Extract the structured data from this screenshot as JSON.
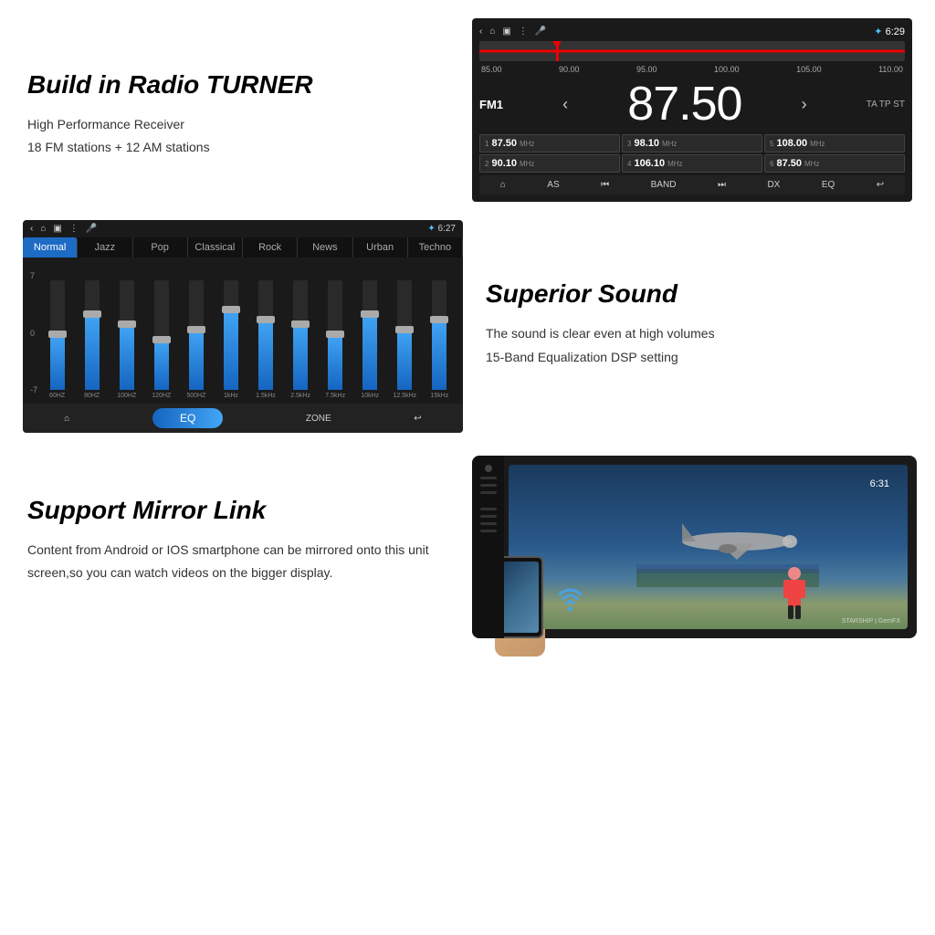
{
  "sections": {
    "radio": {
      "title": "Build in Radio TURNER",
      "feature1": "High Performance Receiver",
      "feature2": "18 FM stations + 12 AM stations",
      "screen": {
        "time": "6:29",
        "band": "FM1",
        "frequency": "87.50",
        "freq_large": "87.50",
        "freq_labels": [
          "85.00",
          "90.00",
          "95.00",
          "100.00",
          "105.00",
          "110.00"
        ],
        "rds": "TA TP ST",
        "presets": [
          {
            "num": "1",
            "freq": "87.50",
            "unit": "MHz"
          },
          {
            "num": "3",
            "freq": "98.10",
            "unit": "MHz"
          },
          {
            "num": "5",
            "freq": "108.00",
            "unit": "MHz"
          },
          {
            "num": "2",
            "freq": "90.10",
            "unit": "MHz"
          },
          {
            "num": "4",
            "freq": "106.10",
            "unit": "MHz"
          },
          {
            "num": "6",
            "freq": "87.50",
            "unit": "MHz"
          }
        ],
        "toolbar_buttons": [
          "🏠",
          "AS",
          "⏮",
          "BAND",
          "⏭",
          "DX",
          "EQ",
          "↩"
        ]
      }
    },
    "equalizer": {
      "screen": {
        "time": "6:27",
        "tabs": [
          "Normal",
          "Jazz",
          "Pop",
          "Classical",
          "Rock",
          "News",
          "Urban",
          "Techno"
        ],
        "active_tab": "Normal",
        "labels_left": [
          "7",
          "",
          "0",
          "",
          "-7"
        ],
        "bands": [
          {
            "label": "60HZ",
            "height_pct": 55,
            "thumb_pct": 55
          },
          {
            "label": "80HZ",
            "height_pct": 75,
            "thumb_pct": 75
          },
          {
            "label": "100HZ",
            "height_pct": 65,
            "thumb_pct": 65
          },
          {
            "label": "120HZ",
            "height_pct": 50,
            "thumb_pct": 50
          },
          {
            "label": "500HZ",
            "height_pct": 60,
            "thumb_pct": 60
          },
          {
            "label": "1kHz",
            "height_pct": 80,
            "thumb_pct": 80
          },
          {
            "label": "1.5kHz",
            "height_pct": 70,
            "thumb_pct": 70
          },
          {
            "label": "2.5kHz",
            "height_pct": 65,
            "thumb_pct": 65
          },
          {
            "label": "7.5kHz",
            "height_pct": 55,
            "thumb_pct": 55
          },
          {
            "label": "10kHz",
            "height_pct": 75,
            "thumb_pct": 75
          },
          {
            "label": "12.5kHz",
            "height_pct": 60,
            "thumb_pct": 60
          },
          {
            "label": "15kHz",
            "height_pct": 70,
            "thumb_pct": 70
          }
        ],
        "toolbar": {
          "home": "🏠",
          "eq_label": "EQ",
          "zone": "ZONE",
          "back": "↩"
        }
      }
    },
    "sound": {
      "title": "Superior Sound",
      "feature1": "The sound is clear even at high volumes",
      "feature2": "15-Band Equalization DSP setting"
    },
    "mirror": {
      "title": "Support Mirror Link",
      "description": "Content from Android or IOS smartphone can be mirrored onto this unit screen,so you can watch videos on the  bigger display.",
      "screen": {
        "time": "6:31"
      }
    }
  },
  "colors": {
    "accent_blue": "#1565c0",
    "light_blue": "#42a5f5",
    "red": "#e00000",
    "dark_bg": "#1a1a1a",
    "active_tab": "#1e6bc4"
  }
}
